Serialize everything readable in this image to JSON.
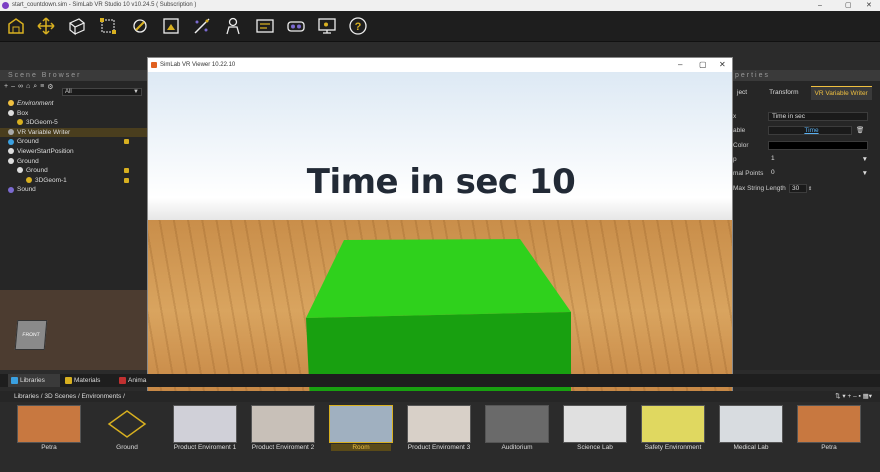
{
  "app": {
    "window_title": "start_countdown.sim - SimLab VR Studio 10 v10.24.5 ( Subscription )"
  },
  "scene_browser": {
    "header": "Scene Browser",
    "filter_value": "All",
    "tree": [
      {
        "label": "Environment",
        "level": 0,
        "icon_color": "#f0c040",
        "italic": true
      },
      {
        "label": "Box",
        "level": 0,
        "icon_color": "#dddddd"
      },
      {
        "label": "3DGeom-5",
        "level": 1,
        "icon_color": "#d8b020"
      },
      {
        "label": "VR Variable Writer",
        "level": 0,
        "icon_color": "#aaaaaa",
        "selected": true
      },
      {
        "label": "Ground",
        "level": 0,
        "icon_color": "#3aa0e0",
        "locked": true
      },
      {
        "label": "ViewerStartPosition",
        "level": 0,
        "icon_color": "#dddddd"
      },
      {
        "label": "Ground",
        "level": 0,
        "icon_color": "#dddddd"
      },
      {
        "label": "Ground",
        "level": 1,
        "icon_color": "#dddddd",
        "locked": true
      },
      {
        "label": "3DGeom-1",
        "level": 2,
        "icon_color": "#d8b020",
        "locked": true
      },
      {
        "label": "Sound",
        "level": 0,
        "icon_color": "#7b6ad0"
      }
    ]
  },
  "properties": {
    "header": "perties",
    "tabs": [
      "ject",
      "Transform",
      "VR Variable Writer"
    ],
    "rows": [
      {
        "label": "x",
        "value": "Time in sec"
      },
      {
        "label": "able",
        "value": "Time"
      },
      {
        "label": "Color",
        "value": ""
      },
      {
        "label": "p",
        "value": "1"
      },
      {
        "label": "mal Points",
        "value": "0"
      },
      {
        "label": "Max String Length",
        "value": "30"
      }
    ]
  },
  "viewer": {
    "title": "SimLab VR Viewer 10.22.10",
    "scene_text": "Time in sec 10",
    "box_color": "#2fd11c"
  },
  "viewport": {
    "cube_label": "FRONT"
  },
  "library": {
    "tabs": [
      "Libraries",
      "Materials",
      "Anima"
    ],
    "breadcrumb": "Libraries  /  3D Scenes  /  Environments  /",
    "items": [
      {
        "label": "Petra"
      },
      {
        "label": "Ground"
      },
      {
        "label": "Product Enviroment 1"
      },
      {
        "label": "Product Enviroment 2"
      },
      {
        "label": "Room",
        "selected": true
      },
      {
        "label": "Product Enviroment 3"
      },
      {
        "label": "Auditorium"
      },
      {
        "label": "Science Lab"
      },
      {
        "label": "Safety Environment"
      },
      {
        "label": "Medical Lab"
      },
      {
        "label": "Petra"
      }
    ]
  },
  "toolbar_icons": [
    "environment-icon",
    "move-icon",
    "material-icon",
    "bounding-box-icon",
    "explode-icon",
    "texture-icon",
    "animation-icon",
    "avatar-icon",
    "form-icon",
    "vr-headset-icon",
    "presentation-icon",
    "help-icon"
  ]
}
